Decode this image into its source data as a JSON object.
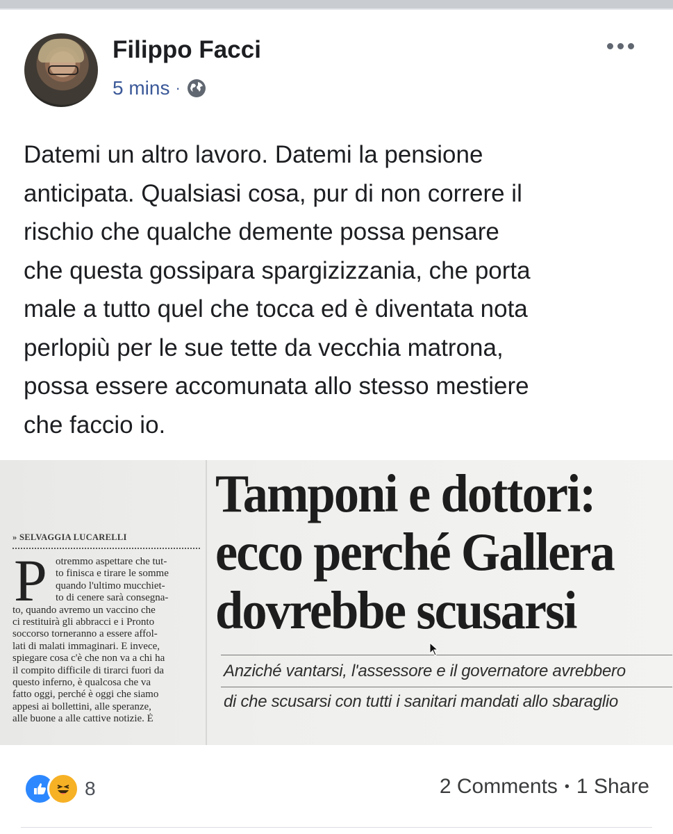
{
  "post": {
    "author": "Filippo Facci",
    "time": "5 mins",
    "separator": "·",
    "privacy_icon": "globe-icon",
    "more_icon": "more-options-icon",
    "text": "Datemi un altro lavoro. Datemi la pensione\nanticipata. Qualsiasi cosa, pur di non correre il\nrischio che qualche demente possa pensare\nche questa gossipara spargizizzania, che porta\nmale a tutto quel che tocca ed è diventata nota\nperlopiù per le sue tette da vecchia matrona,\npossa essere accomunata allo stesso mestiere\nche faccio io."
  },
  "clipping": {
    "byline": "» SELVAGGIA LUCARELLI",
    "dropcap": "P",
    "body_lines": [
      "otremmo aspettare che tut-",
      "to finisca e tirare le somme",
      "quando l'ultimo mucchiet-",
      "to di cenere sarà consegna-",
      "to, quando avremo un vaccino che",
      "ci restituirà gli abbracci e i Pronto",
      "soccorso torneranno a essere affol-",
      "lati di malati immaginari. E invece,",
      "spiegare cosa c'è che non va a chi ha",
      "il compito difficile di tirarci fuori da",
      "questo inferno, è qualcosa che va",
      "fatto oggi, perché è oggi che siamo",
      "appesi ai bollettini, alle speranze,",
      "alle buone a alle cattive notizie. È"
    ],
    "headline": "Tamponi e dottori:\necco perché Gallera\ndovrebbe scusarsi",
    "subhead_lines": [
      "Anziché vantarsi, l'assessore e il governatore avrebbero",
      "di che scusarsi con tutti i sanitari mandati allo sbaraglio"
    ]
  },
  "footer": {
    "reactions": [
      "like",
      "haha"
    ],
    "reaction_count": "8",
    "comments": "2 Comments",
    "separator": "•",
    "shares": "1 Share"
  },
  "colors": {
    "link": "#3b5998",
    "like": "#2d88ff",
    "haha": "#f7b125"
  }
}
